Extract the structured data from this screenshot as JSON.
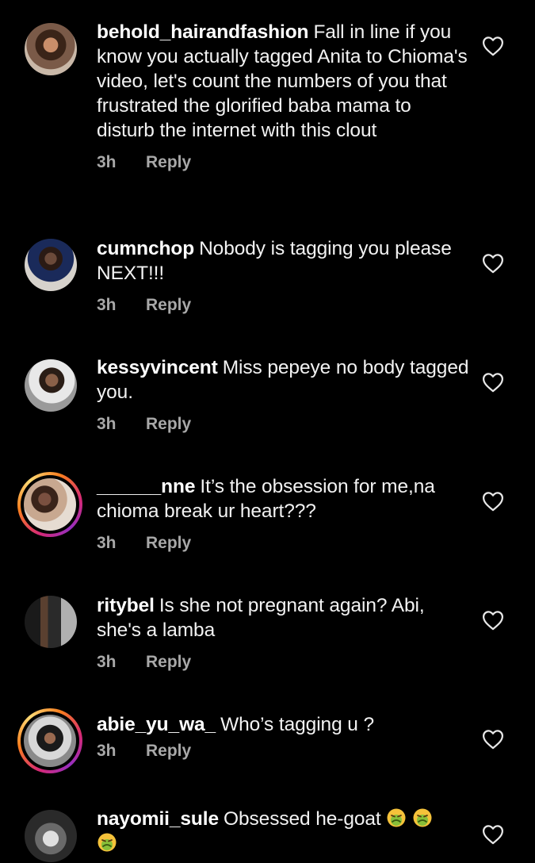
{
  "comments": [
    {
      "username": "behold_hairandfashion",
      "text": "Fall in line if you know you actually tagged Anita to Chioma's video, let's count the numbers of you that frustrated the glorified baba mama to disturb the internet with this clout",
      "time": "3h",
      "reply": "Reply"
    },
    {
      "username": "cumnchop",
      "text": "Nobody is tagging you please NEXT!!!",
      "time": "3h",
      "reply": "Reply"
    },
    {
      "username": "kessyvincent",
      "text": "Miss pepeye no body tagged you.",
      "time": "3h",
      "reply": "Reply"
    },
    {
      "username": "______nne",
      "text": "It’s the obsession for me,na chioma break ur heart???",
      "time": "3h",
      "reply": "Reply"
    },
    {
      "username": "ritybel",
      "text": "Is she not pregnant again? Abi, she's a lamba",
      "time": "3h",
      "reply": "Reply"
    },
    {
      "username": "abie_yu_wa_",
      "text": "Who’s tagging u ?",
      "time": "3h",
      "reply": "Reply"
    },
    {
      "username": "nayomii_sule",
      "text": "Obsessed he-goat",
      "time": "",
      "reply": ""
    }
  ],
  "icons": {
    "like": "heart-outline-icon",
    "emoji": "nauseated-face-emoji"
  },
  "colors": {
    "background": "#000000",
    "text": "#f2f2f2",
    "secondary": "#a8a8a8"
  }
}
